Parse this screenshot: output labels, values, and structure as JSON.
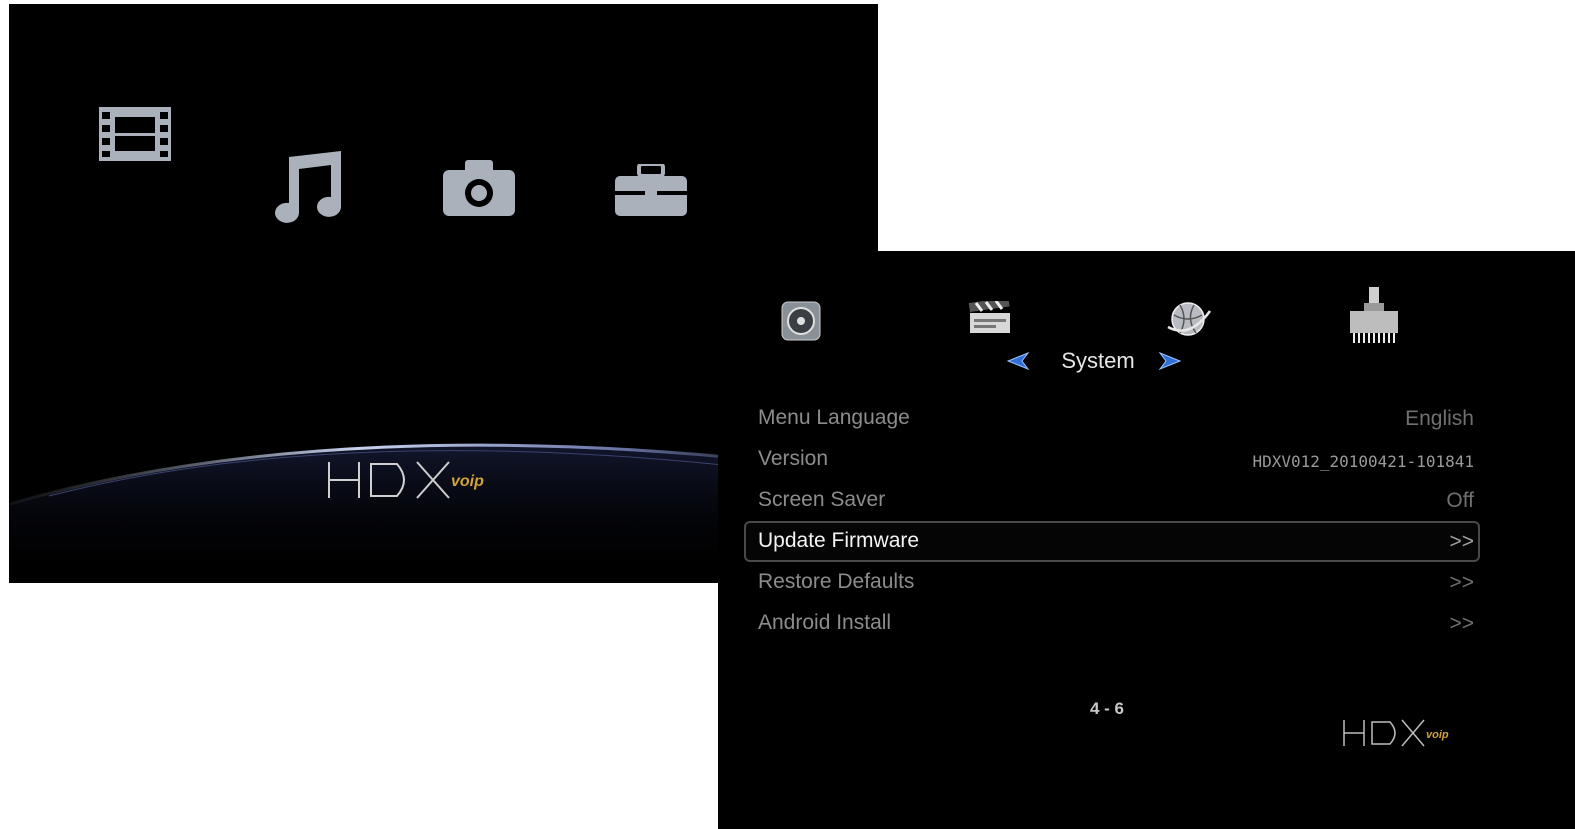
{
  "home": {
    "icons": [
      "film-icon",
      "music-note-icon",
      "camera-icon",
      "toolbox-icon"
    ],
    "logo": "HDX voip"
  },
  "settings": {
    "category_icons": [
      "settings-disc-icon",
      "clapperboard-icon",
      "network-globe-icon",
      "ethernet-port-icon"
    ],
    "category": "System",
    "menu_items": [
      {
        "label": "Menu Language",
        "value": "English"
      },
      {
        "label": "Version",
        "value": "HDXV012_20100421-101841"
      },
      {
        "label": "Screen Saver",
        "value": "Off"
      },
      {
        "label": "Update Firmware",
        "value": ">>",
        "selected": true
      },
      {
        "label": "Restore Defaults",
        "value": ">>"
      },
      {
        "label": "Android Install",
        "value": ">>"
      }
    ],
    "page_indicator": "4 - 6",
    "logo": "HDX voip"
  },
  "colors": {
    "background": "#000000",
    "icon_gray": "#aab1bb",
    "arrow_blue": "#2f6fd6",
    "logo_gold": "#d4a23c"
  }
}
